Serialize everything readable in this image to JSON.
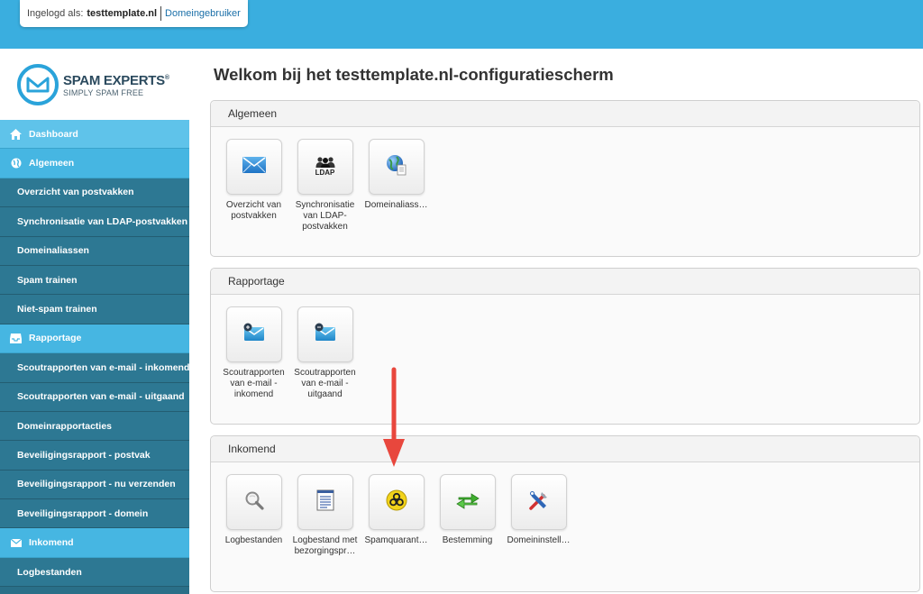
{
  "topbar": {
    "login_label": "Ingelogd als:",
    "user": "testtemplate.nl",
    "role": "Domeingebruiker"
  },
  "logo": {
    "title": "SPAM EXPERTS",
    "registered": "®",
    "subtitle": "SIMPLY SPAM FREE"
  },
  "sidebar": {
    "items": [
      {
        "label": "Dashboard",
        "type": "section",
        "icon": "home-icon",
        "active": true
      },
      {
        "label": "Algemeen",
        "type": "section",
        "icon": "globe-icon"
      },
      {
        "label": "Overzicht van postvakken",
        "type": "item"
      },
      {
        "label": "Synchronisatie van LDAP-postvakken",
        "type": "item"
      },
      {
        "label": "Domeinaliassen",
        "type": "item"
      },
      {
        "label": "Spam trainen",
        "type": "item"
      },
      {
        "label": "Niet-spam trainen",
        "type": "item"
      },
      {
        "label": "Rapportage",
        "type": "section",
        "icon": "inbox-icon"
      },
      {
        "label": "Scoutrapporten van e-mail - inkomend",
        "type": "item"
      },
      {
        "label": "Scoutrapporten van e-mail - uitgaand",
        "type": "item"
      },
      {
        "label": "Domeinrapportacties",
        "type": "item"
      },
      {
        "label": "Beveiligingsrapport - postvak",
        "type": "item"
      },
      {
        "label": "Beveiligingsrapport - nu verzenden",
        "type": "item"
      },
      {
        "label": "Beveiligingsrapport - domein",
        "type": "item"
      },
      {
        "label": "Inkomend",
        "type": "section",
        "icon": "envelope-icon"
      },
      {
        "label": "Logbestanden",
        "type": "item"
      }
    ]
  },
  "main": {
    "title": "Welkom bij het testtemplate.nl-configuratiescherm",
    "panels": [
      {
        "title": "Algemeen",
        "tiles": [
          {
            "label": "Overzicht van postvakken",
            "icon": "envelope-icon"
          },
          {
            "label": "Synchronisatie van LDAP-postvakken",
            "icon": "ldap-users-icon",
            "icon_text": "LDAP"
          },
          {
            "label": "Domeinaliass…",
            "icon": "globe-document-icon"
          }
        ]
      },
      {
        "title": "Rapportage",
        "tiles": [
          {
            "label": "Scoutrapporten van e-mail - inkomend",
            "icon": "incoming-mail-report-icon"
          },
          {
            "label": "Scoutrapporten van e-mail - uitgaand",
            "icon": "outgoing-mail-report-icon"
          }
        ]
      },
      {
        "title": "Inkomend",
        "tiles": [
          {
            "label": "Logbestanden",
            "icon": "magnifier-icon"
          },
          {
            "label": "Logbestand met bezorgingspr…",
            "icon": "log-document-icon"
          },
          {
            "label": "Spamquarant…",
            "icon": "biohazard-icon"
          },
          {
            "label": "Bestemming",
            "icon": "green-arrows-icon"
          },
          {
            "label": "Domeininstell…",
            "icon": "tools-icon"
          }
        ]
      }
    ]
  },
  "colors": {
    "topbar": "#3aaedf",
    "sidebar_section": "#46b6e2",
    "sidebar_item": "#2d7893",
    "annotation_arrow": "#e8473d"
  }
}
